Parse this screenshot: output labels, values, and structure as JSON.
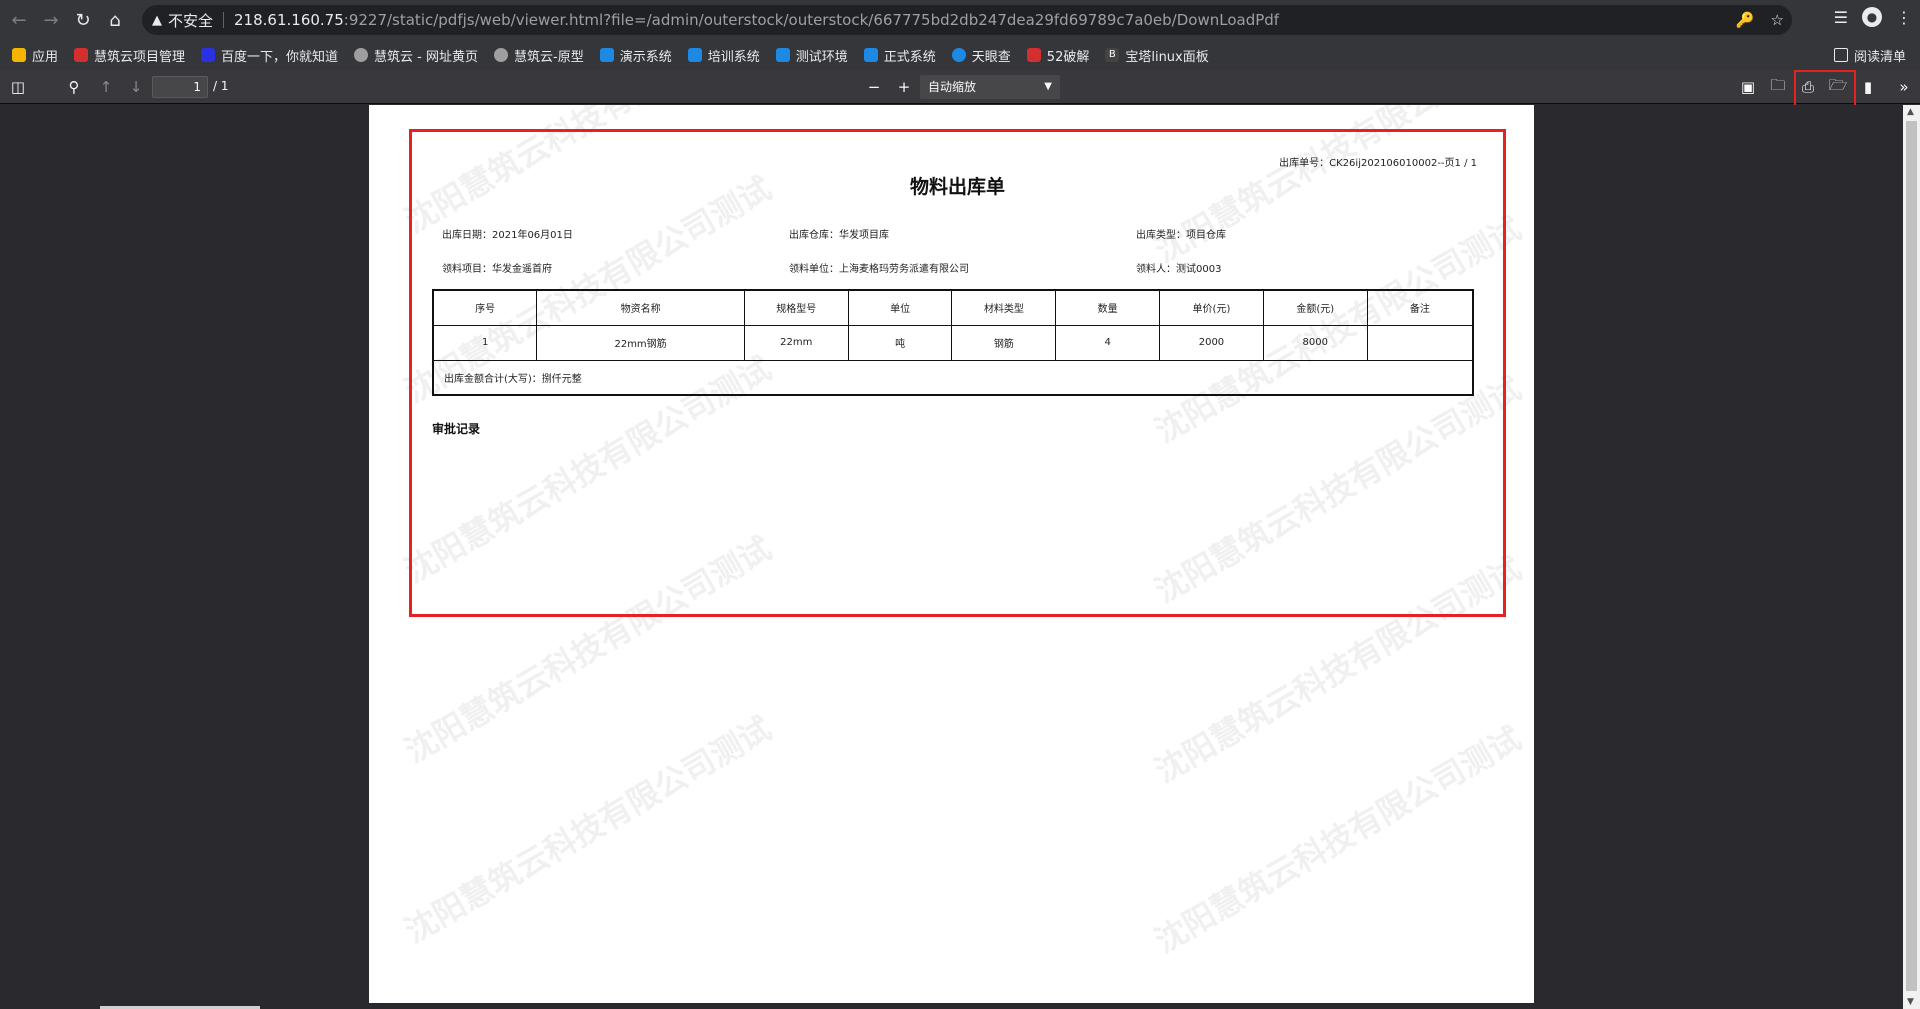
{
  "browser": {
    "security_label": "不安全",
    "url_host": "218.61.160.75",
    "url_path": ":9227/static/pdfjs/web/viewer.html?file=/admin/outerstock/outerstock/667775bd2db247dea29fd69789c7a0eb/DownLoadPdf",
    "bookmarks": [
      {
        "label": "应用",
        "icon": "apps-grid-icon",
        "color": "#f4b400"
      },
      {
        "label": "慧筑云项目管理",
        "icon": "site-icon",
        "color": "#d32f2f"
      },
      {
        "label": "百度一下，你就知道",
        "icon": "baidu-icon",
        "color": "#2932e1"
      },
      {
        "label": "慧筑云 - 网址黄页",
        "icon": "globe-icon",
        "color": "#9e9e9e"
      },
      {
        "label": "慧筑云-原型",
        "icon": "globe-icon",
        "color": "#9e9e9e"
      },
      {
        "label": "演示系统",
        "icon": "site-icon",
        "color": "#1e88e5"
      },
      {
        "label": "培训系统",
        "icon": "site-icon",
        "color": "#1e88e5"
      },
      {
        "label": "测试环境",
        "icon": "site-icon",
        "color": "#1e88e5"
      },
      {
        "label": "正式系统",
        "icon": "site-icon",
        "color": "#1e88e5"
      },
      {
        "label": "天眼查",
        "icon": "tianyancha-icon",
        "color": "#1e88e5"
      },
      {
        "label": "52破解",
        "icon": "site-icon",
        "color": "#d32f2f"
      },
      {
        "label": "宝塔linux面板",
        "icon": "bt-icon",
        "color": "#444444"
      }
    ],
    "reading_list": "阅读清单"
  },
  "pdf_toolbar": {
    "page_number": "1",
    "page_count": "/ 1",
    "zoom": "自动缩放"
  },
  "document": {
    "doc_number": "出库单号：CK26ij202106010002--页1 / 1",
    "title": "物料出库单",
    "info": {
      "date": "出库日期：2021年06月01日",
      "warehouse": "出库仓库：华发项目库",
      "type": "出库类型：项目仓库",
      "project": "领料项目：华发金遥首府",
      "unit": "领料单位：上海麦格玛劳务派遣有限公司",
      "person": "领料人：测试0003"
    },
    "table": {
      "headers": [
        "序号",
        "物资名称",
        "规格型号",
        "单位",
        "材料类型",
        "数量",
        "单价(元)",
        "金额(元)",
        "备注"
      ],
      "rows": [
        [
          "1",
          "22mm钢筋",
          "22mm",
          "吨",
          "钢筋",
          "4",
          "2000",
          "8000",
          ""
        ]
      ],
      "total_label": "出库金额合计(大写)：捌仟元整"
    },
    "approval_title": "审批记录",
    "watermark": "沈阳慧筑云科技有限公司测试"
  }
}
